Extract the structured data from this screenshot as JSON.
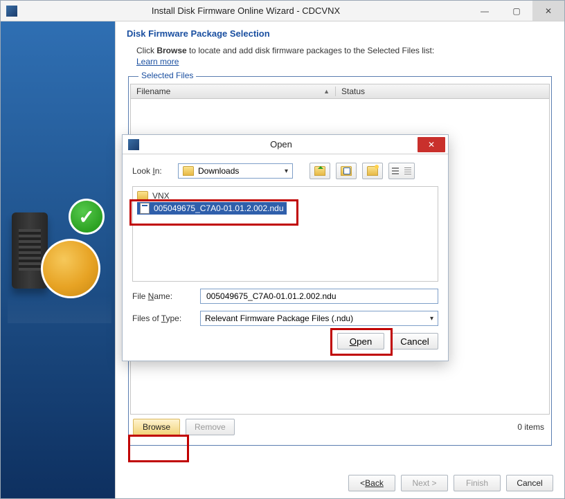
{
  "window": {
    "title": "Install Disk Firmware Online Wizard - CDCVNX"
  },
  "section": {
    "title": "Disk Firmware Package Selection",
    "intro_prefix": "Click ",
    "intro_bold": "Browse",
    "intro_suffix": " to locate and add disk firmware packages to the Selected Files list:",
    "learn_more": "Learn more"
  },
  "selected_files": {
    "group_label": "Selected Files",
    "columns": {
      "filename": "Filename",
      "status": "Status"
    },
    "rows": [],
    "browse_label": "Browse",
    "remove_label": "Remove",
    "items_text": "0 items"
  },
  "wizard_buttons": {
    "back": "Back",
    "next": "Next >",
    "finish": "Finish",
    "cancel": "Cancel"
  },
  "open_dialog": {
    "title": "Open",
    "look_in_label": "Look In:",
    "look_in_value": "Downloads",
    "folder": "VNX",
    "selected_file": "005049675_C7A0-01.01.2.002.ndu",
    "file_name_label": "File Name:",
    "file_name_value": "005049675_C7A0-01.01.2.002.ndu",
    "files_of_type_label": "Files of Type:",
    "files_of_type_value": "Relevant Firmware Package Files (.ndu)",
    "open_btn": "Open",
    "cancel_btn": "Cancel"
  }
}
